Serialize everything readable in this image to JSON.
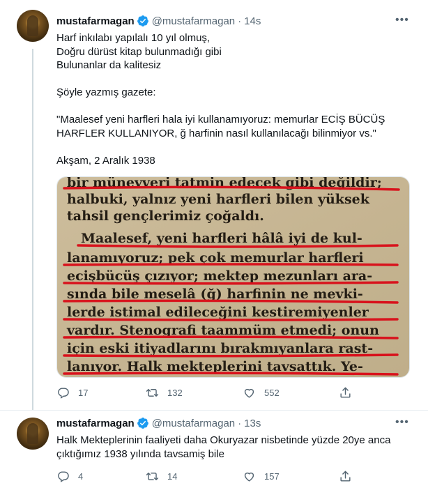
{
  "tweets": [
    {
      "display_name": "mustafarmagan",
      "handle": "@mustafarmagan",
      "separator": "·",
      "time": "14s",
      "lines": [
        "Harf inkılabı yapılalı 10 yıl olmuş,",
        "Doğru dürüst kitap bulunmadığı gibi",
        "Bulunanlar da kalitesiz",
        "",
        "Şöyle yazmış gazete:",
        "",
        "\"Maalesef yeni harfleri hala iyi kullanamıyoruz: memurlar ECİŞ BÜCÜŞ",
        "HARFLER KULLANIYOR, ğ harfinin nasıl kullanılacağı bilinmiyor vs.\"",
        "",
        "Akşam, 2 Aralık 1938"
      ],
      "photo_lines": [
        "bir münevveri tatmin edecek gibi değildir;",
        "halbuki, yalnız yeni harfleri bilen yüksek",
        "tahsil gençlerimiz çoğaldı.",
        "Maalesef, yeni harfleri hâlâ iyi de kul-",
        "lanamıyoruz; pek çok memurlar harfleri",
        "ecişbücüş çızıyor; mektep mezunları ara-",
        "sında bile meselâ (ğ) harfinin ne mevki-",
        "lerde istimal edileceğini kestiremiyenler",
        "vardır. Stenografi taammüm etmedi; onun",
        "için eski itiyadlarını bırakmıyanlara rast-",
        "lanıyor. Halk mekteplerini tavsattık. Ye-"
      ],
      "reply_count": "17",
      "retweet_count": "132",
      "like_count": "552"
    },
    {
      "display_name": "mustafarmagan",
      "handle": "@mustafarmagan",
      "separator": "·",
      "time": "13s",
      "lines": [
        "Halk Mekteplerinin faaliyeti daha Okuryazar nisbetinde yüzde 20ye anca",
        "çıktığımız 1938 yılında tavsamiş bile"
      ],
      "reply_count": "4",
      "retweet_count": "14",
      "like_count": "157"
    }
  ],
  "icons": {
    "verified": "verified-badge-icon",
    "more": "more-horizontal-icon",
    "reply": "reply-icon",
    "retweet": "retweet-icon",
    "like": "heart-icon",
    "share": "share-icon"
  },
  "colors": {
    "verified": "#1d9bf0",
    "secondary_text": "#536471",
    "primary_text": "#0f1419",
    "divider": "#e6ecf0",
    "thread_line": "#cfd9de",
    "newspaper_paper": "#c9b998",
    "underline_red": "#d8121c"
  }
}
